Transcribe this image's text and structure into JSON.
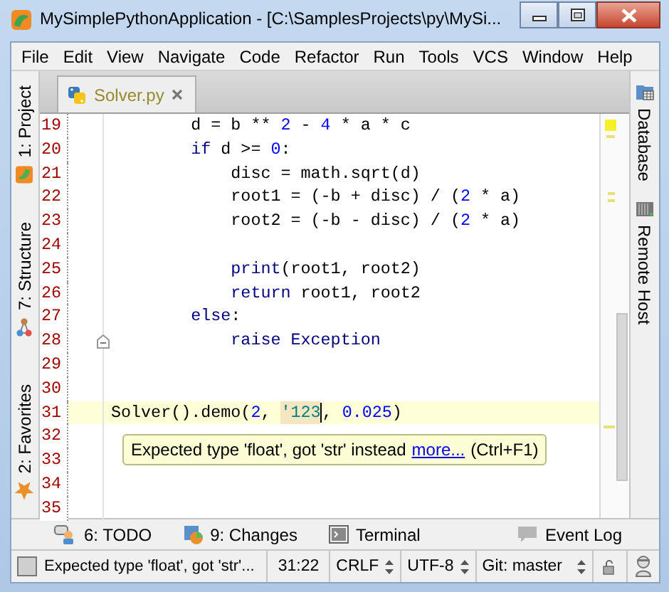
{
  "window": {
    "title": "MySimplePythonApplication - [C:\\SamplesProjects\\py\\MySi..."
  },
  "menu": [
    {
      "label": "File"
    },
    {
      "label": "Edit"
    },
    {
      "label": "View"
    },
    {
      "label": "Navigate"
    },
    {
      "label": "Code"
    },
    {
      "label": "Refactor"
    },
    {
      "label": "Run"
    },
    {
      "label": "Tools"
    },
    {
      "label": "VCS"
    },
    {
      "label": "Window"
    },
    {
      "label": "Help"
    }
  ],
  "left_tool_windows": [
    {
      "label": "1: Project",
      "kind": "project"
    },
    {
      "label": "7: Structure",
      "kind": "structure"
    },
    {
      "label": "2: Favorites",
      "kind": "favorites"
    }
  ],
  "right_tool_windows": [
    {
      "label": "Database",
      "kind": "database"
    },
    {
      "label": "Remote Host",
      "kind": "remote"
    }
  ],
  "editor_tabs": [
    {
      "label": "Solver.py",
      "selected": true
    }
  ],
  "editor": {
    "lines": [
      {
        "number": "19",
        "current": false,
        "fold": false,
        "tokens": [
          {
            "kind": "plain",
            "text": "        d = b ** "
          },
          {
            "kind": "number",
            "text": "2"
          },
          {
            "kind": "plain",
            "text": " - "
          },
          {
            "kind": "number",
            "text": "4"
          },
          {
            "kind": "plain",
            "text": " * a * c"
          }
        ]
      },
      {
        "number": "20",
        "current": false,
        "fold": false,
        "tokens": [
          {
            "kind": "keyword",
            "text": "        if"
          },
          {
            "kind": "plain",
            "text": " d >= "
          },
          {
            "kind": "number",
            "text": "0"
          },
          {
            "kind": "plain",
            "text": ":"
          }
        ]
      },
      {
        "number": "21",
        "current": false,
        "fold": false,
        "tokens": [
          {
            "kind": "plain",
            "text": "            disc = math.sqrt(d)"
          }
        ]
      },
      {
        "number": "22",
        "current": false,
        "fold": false,
        "tokens": [
          {
            "kind": "plain",
            "text": "            root1 = (-b + disc) / ("
          },
          {
            "kind": "number",
            "text": "2"
          },
          {
            "kind": "plain",
            "text": " * a)"
          }
        ]
      },
      {
        "number": "23",
        "current": false,
        "fold": false,
        "tokens": [
          {
            "kind": "plain",
            "text": "            root2 = (-b - disc) / ("
          },
          {
            "kind": "number",
            "text": "2"
          },
          {
            "kind": "plain",
            "text": " * a)"
          }
        ]
      },
      {
        "number": "24",
        "current": false,
        "fold": false
      },
      {
        "number": "25",
        "current": false,
        "fold": false,
        "tokens": [
          {
            "kind": "keyword",
            "text": "            print"
          },
          {
            "kind": "plain",
            "text": "(root1, root2)"
          }
        ]
      },
      {
        "number": "26",
        "current": false,
        "fold": false,
        "tokens": [
          {
            "kind": "keyword",
            "text": "            return"
          },
          {
            "kind": "plain",
            "text": " root1, root2"
          }
        ]
      },
      {
        "number": "27",
        "current": false,
        "fold": false,
        "tokens": [
          {
            "kind": "keyword",
            "text": "        else"
          },
          {
            "kind": "plain",
            "text": ":"
          }
        ]
      },
      {
        "number": "28",
        "current": false,
        "fold": true,
        "tokens": [
          {
            "kind": "keyword",
            "text": "            raise Exception"
          }
        ]
      },
      {
        "number": "29",
        "current": false,
        "fold": false
      },
      {
        "number": "30",
        "current": false,
        "fold": false
      },
      {
        "number": "31",
        "current": true,
        "fold": false,
        "tokens": [
          {
            "kind": "plain",
            "text": "Solver().demo("
          },
          {
            "kind": "number",
            "text": "2"
          },
          {
            "kind": "plain",
            "text": ", "
          },
          {
            "kind": "warning_string",
            "text": "'123"
          },
          {
            "kind": "caret"
          },
          {
            "kind": "plain",
            "text": ", "
          },
          {
            "kind": "number",
            "text": "0.025"
          },
          {
            "kind": "plain",
            "text": ")"
          }
        ]
      },
      {
        "number": "32",
        "current": false,
        "fold": false
      },
      {
        "number": "33",
        "current": false,
        "fold": false
      },
      {
        "number": "34",
        "current": false,
        "fold": false
      },
      {
        "number": "35",
        "current": false,
        "fold": false
      }
    ],
    "tooltip": {
      "text": "Expected type 'float', got 'str' instead",
      "link": "more...",
      "shortcut": "(Ctrl+F1)"
    }
  },
  "bottom_tool_windows": [
    {
      "label": "6: TODO",
      "kind": "todo"
    },
    {
      "label": "9: Changes",
      "kind": "changes"
    },
    {
      "label": "Terminal",
      "kind": "terminal"
    },
    {
      "label": "Event Log",
      "kind": "event_log"
    }
  ],
  "status_bar": {
    "message": "Expected type 'float', got 'str'...",
    "position": "31:22",
    "line_separator": "CRLF",
    "encoding": "UTF-8",
    "vcs": "Git: master"
  }
}
